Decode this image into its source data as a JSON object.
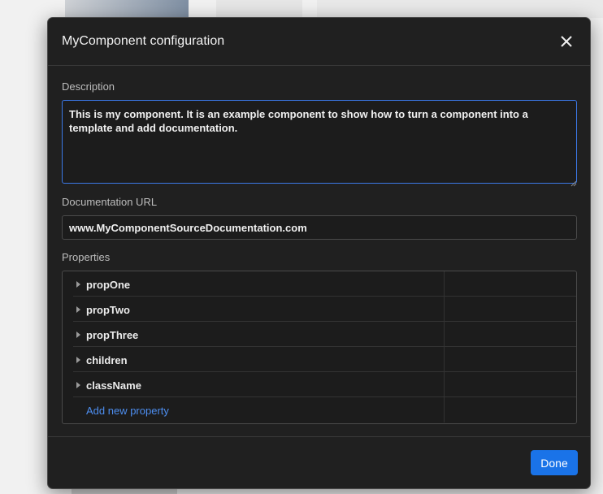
{
  "dialog": {
    "title": "MyComponent configuration",
    "close_icon": "close-icon"
  },
  "description": {
    "label": "Description",
    "value": "This is my component. It is an example component to show how to turn a component into a template and add documentation."
  },
  "documentation_url": {
    "label": "Documentation URL",
    "value": "www.MyComponentSourceDocumentation.com"
  },
  "properties": {
    "label": "Properties",
    "items": [
      {
        "name": "propOne"
      },
      {
        "name": "propTwo"
      },
      {
        "name": "propThree"
      },
      {
        "name": "children"
      },
      {
        "name": "className"
      }
    ],
    "add_label": "Add new property"
  },
  "footer": {
    "done_label": "Done"
  },
  "colors": {
    "accent": "#1a73e8",
    "link": "#4d8ef0",
    "dialog_bg": "#202020",
    "focus_border": "#3b78e7"
  }
}
